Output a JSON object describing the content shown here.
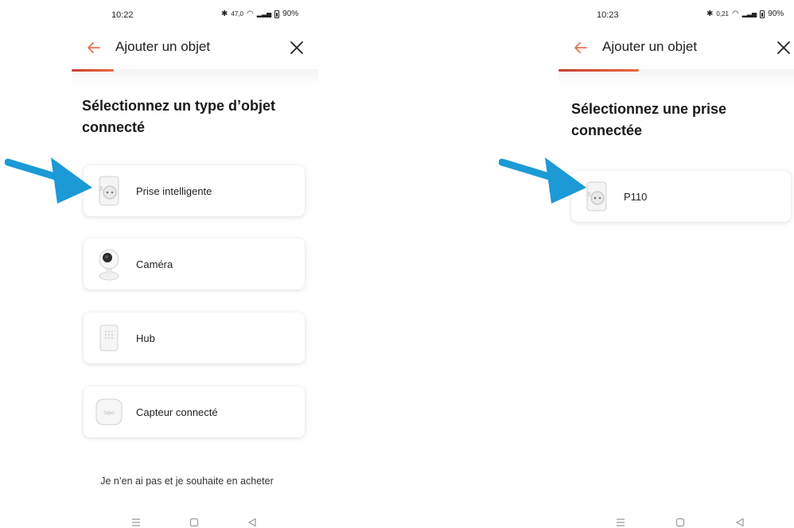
{
  "colors": {
    "accent": "#e8704a",
    "progress": "#c73c2e",
    "callout_arrow": "#1b9ad6"
  },
  "left_screen": {
    "status": {
      "time": "10:22",
      "net_speed": "47,0",
      "battery": "90%"
    },
    "header": {
      "title": "Ajouter un objet",
      "back_icon": "arrow-left-icon",
      "close_icon": "close-icon"
    },
    "progress": {
      "fraction": 0.17
    },
    "title": [
      "Sélectionnez un type d’objet",
      "connecté"
    ],
    "devices": [
      {
        "label": "Prise intelligente",
        "icon": "smart-plug-icon"
      },
      {
        "label": "Caméra",
        "icon": "camera-icon"
      },
      {
        "label": "Hub",
        "icon": "hub-icon"
      },
      {
        "label": "Capteur connecté",
        "icon": "sensor-icon",
        "badge": "tapo"
      }
    ],
    "bottom_link": "Je n’en ai pas et je souhaite en acheter"
  },
  "right_screen": {
    "status": {
      "time": "10:23",
      "net_speed": "0,21",
      "battery": "90%"
    },
    "header": {
      "title": "Ajouter un objet",
      "back_icon": "arrow-left-icon",
      "close_icon": "close-icon"
    },
    "progress": {
      "fraction": 0.34
    },
    "title": [
      "Sélectionnez une prise",
      "connectée"
    ],
    "devices": [
      {
        "label": "P110",
        "icon": "smart-plug-icon"
      }
    ]
  },
  "nav_bar": {
    "icons": [
      "menu-icon",
      "home-icon",
      "back-triangle-icon"
    ]
  }
}
